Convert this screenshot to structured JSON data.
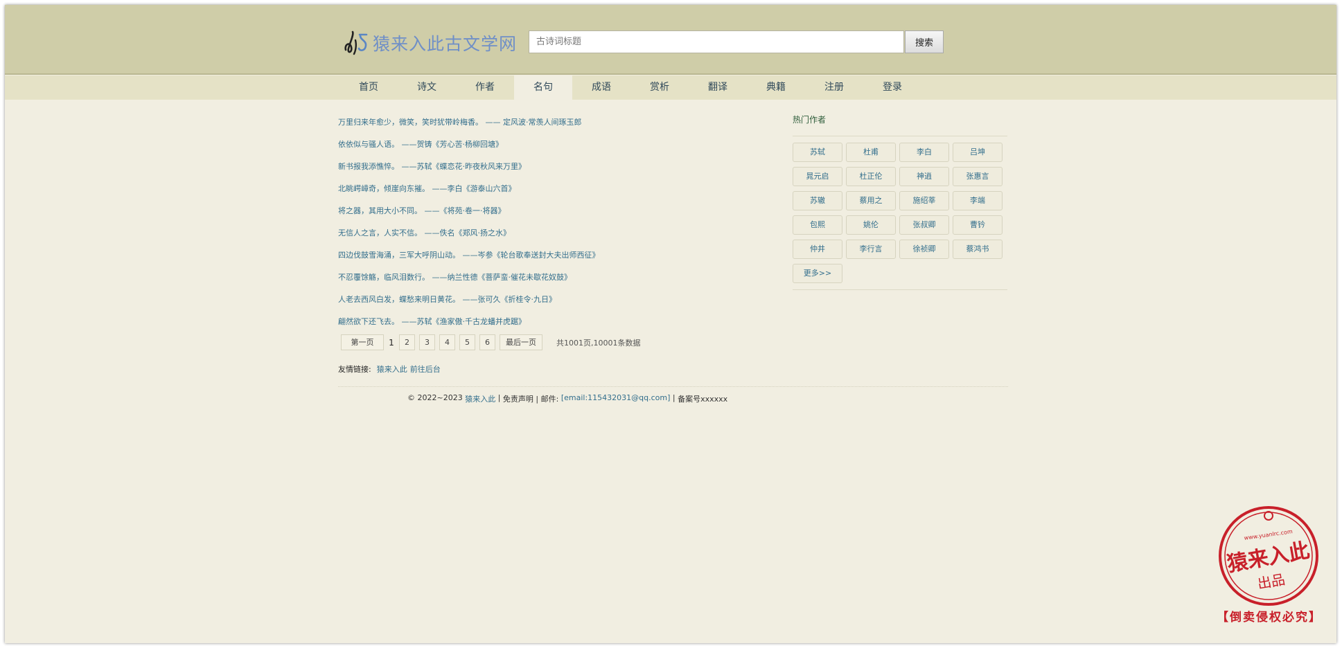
{
  "site": {
    "title": "猿来入此古文学网"
  },
  "search": {
    "placeholder": "古诗词标题",
    "button_label": "搜索"
  },
  "nav": {
    "items": [
      "首页",
      "诗文",
      "作者",
      "名句",
      "成语",
      "赏析",
      "翻译",
      "典籍",
      "注册",
      "登录"
    ],
    "active": "名句"
  },
  "quotes": [
    "万里归来年愈少，微笑，笑时犹带岭梅香。 —— 定风波·常羡人间琢玉郎",
    "依依似与骚人语。 ——贺铸《芳心苦·杨柳回塘》",
    "新书报我添憔悴。 ——苏轼《蝶恋花·昨夜秋风来万里》",
    "北眺崿嶂奇，倾崖向东摧。 ——李白《游泰山六首》",
    "将之器，其用大小不同。 ——《将苑·卷一·将器》",
    "无信人之言，人实不信。 ——佚名《郑风·扬之水》",
    "四边伐鼓雪海涌，三军大呼阴山动。 ——岑参《轮台歌奉送封大夫出师西征》",
    "不忍覆馀觞，临风泪数行。 ——纳兰性德《菩萨蛮·催花未歇花奴鼓》",
    "人老去西风白发，蝶愁来明日黄花。 ——张可久《折桂令·九日》",
    "翩然欲下还飞去。 ——苏轼《渔家傲·千古龙蟠并虎踞》"
  ],
  "pagination": {
    "first": "第一页",
    "current": "1",
    "pages": [
      "2",
      "3",
      "4",
      "5",
      "6"
    ],
    "last": "最后一页",
    "info": "共1001页,10001条数据"
  },
  "links": {
    "label": "友情链接:",
    "items": [
      "猿来入此",
      "前往后台"
    ]
  },
  "footer": {
    "copyright": "© 2022~2023 ",
    "site_link": "猿来入此",
    "sep1": " | ",
    "disclaimer": "免责声明",
    "sep2": " | 邮件: ",
    "email": "[email:115432031@qq.com]",
    "sep3": " | ",
    "record": "备案号xxxxxx"
  },
  "sidebar": {
    "title": "热门作者",
    "authors": [
      "苏轼",
      "杜甫",
      "李白",
      "吕坤",
      "晁元启",
      "杜正伦",
      "神逍",
      "张惠言",
      "苏辙",
      "蔡用之",
      "施绍莘",
      "李端",
      "包熙",
      "姚伦",
      "张叔卿",
      "曹钤",
      "仲井",
      "李行言",
      "徐祯卿",
      "蔡鸿书"
    ],
    "more": "更多>>"
  },
  "stamp": {
    "main_text": "猿来入此",
    "sub_text": "出品",
    "url_text": "www.yuanlrc.com",
    "warning": "【倒卖侵权必究】"
  },
  "colors": {
    "header_bg": "#cfcda8",
    "nav_bg": "#e5e2c6",
    "page_bg": "#f1eee1",
    "link": "#326e8c",
    "logo": "#6f8fc7",
    "stamp": "#c8202a"
  }
}
